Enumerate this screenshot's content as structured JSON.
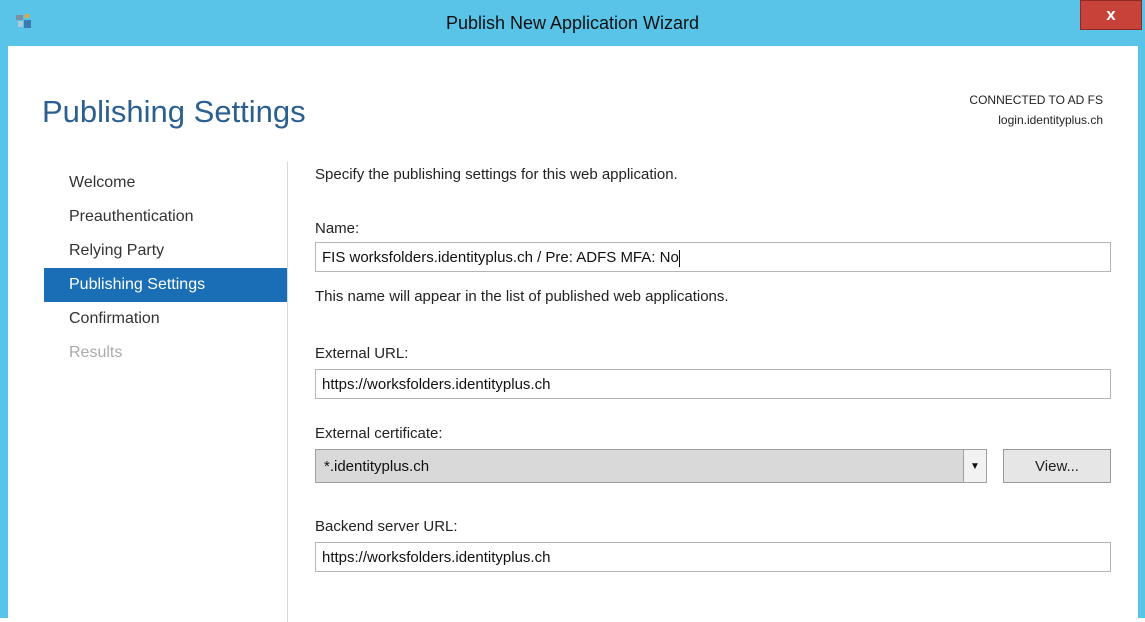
{
  "window": {
    "title": "Publish New Application Wizard",
    "close_label": "x"
  },
  "header": {
    "page_title": "Publishing Settings",
    "connection_label": "CONNECTED TO AD FS",
    "connection_host": "login.identityplus.ch"
  },
  "nav": {
    "items": [
      {
        "label": "Welcome"
      },
      {
        "label": "Preauthentication"
      },
      {
        "label": "Relying Party"
      },
      {
        "label": "Publishing Settings"
      },
      {
        "label": "Confirmation"
      },
      {
        "label": "Results"
      }
    ]
  },
  "form": {
    "intro": "Specify the publishing settings for this web application.",
    "name_label": "Name:",
    "name_value": "FIS worksfolders.identityplus.ch / Pre: ADFS MFA: No",
    "name_help": "This name will appear in the list of published web applications.",
    "external_url_label": "External URL:",
    "external_url_value": "https://worksfolders.identityplus.ch",
    "cert_label": "External certificate:",
    "cert_value": "*.identityplus.ch",
    "view_button": "View...",
    "backend_label": "Backend server URL:",
    "backend_value": "https://worksfolders.identityplus.ch"
  },
  "colors": {
    "titlebar": "#5ac3e8",
    "accent": "#1a6eb5",
    "title_text": "#2a5f8f",
    "close": "#c7433a"
  },
  "icons": {
    "app": "server-wizard-icon",
    "dropdown": "chevron-down-icon"
  }
}
